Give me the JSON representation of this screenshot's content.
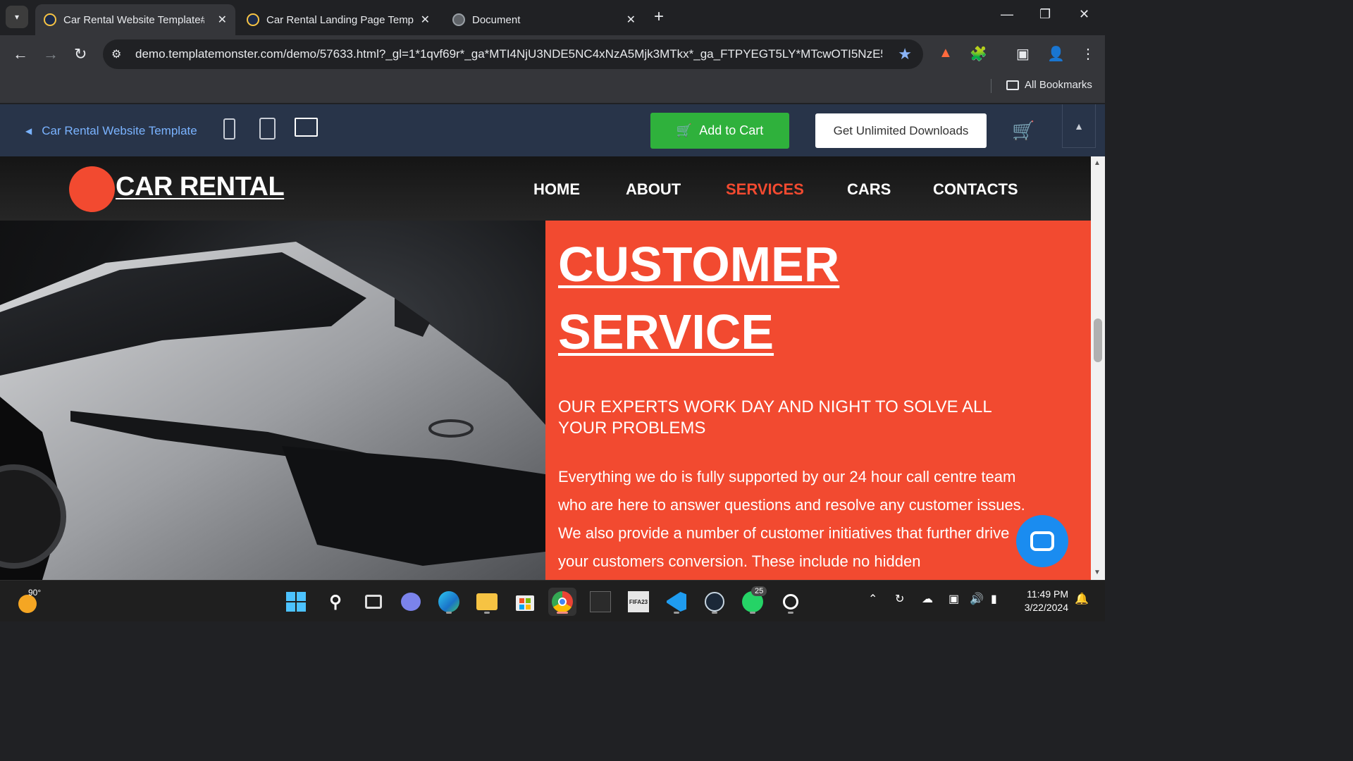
{
  "browser": {
    "tabs": [
      {
        "title": "Car Rental Website Template#5",
        "active": true
      },
      {
        "title": "Car Rental Landing Page Templ...",
        "active": false
      },
      {
        "title": "Document",
        "active": false
      }
    ],
    "url": "demo.templatemonster.com/demo/57633.html?_gl=1*1qvf69r*_ga*MTI4NjU3NDE5NC4xNzA5Mjk3MTkx*_ga_FTPYEGT5LY*MTcwOTI5NzE5...",
    "bookmarks_label": "All Bookmarks",
    "icons": {
      "tab_menu": "▾",
      "new_tab": "+",
      "minimize": "—",
      "restore": "❐",
      "close": "✕",
      "back": "←",
      "forward": "→",
      "reload": "↻",
      "tune": "⚙",
      "star": "★",
      "extension": "🧩",
      "sidepanel": "▣",
      "profile": "👤",
      "more": "⋮"
    }
  },
  "tm_bar": {
    "back_label": "Car Rental Website Template",
    "add_to_cart": "Add to Cart",
    "unlimited": "Get Unlimited Downloads",
    "colors": {
      "bar": "#283449",
      "cart_green": "#2fb13c"
    }
  },
  "site": {
    "logo_text": "CAR RENTAL",
    "nav": [
      {
        "label": "HOME",
        "active": false
      },
      {
        "label": "ABOUT",
        "active": false
      },
      {
        "label": "SERVICES",
        "active": true
      },
      {
        "label": "CARS",
        "active": false
      },
      {
        "label": "CONTACTS",
        "active": false
      }
    ],
    "hero": {
      "title_line1": "CUSTOMER",
      "title_line2": "SERVICE",
      "subtitle": "OUR EXPERTS WORK DAY AND NIGHT TO SOLVE ALL YOUR PROBLEMS",
      "body": "Everything we do is fully supported by our 24 hour call centre team who are here to answer questions and resolve any customer issues. We also provide a number of customer initiatives that further drive your customers conversion. These include no hidden"
    },
    "colors": {
      "accent": "#f24a30",
      "chat_blue": "#1a8cf0"
    }
  },
  "taskbar": {
    "weather_temp": "90°",
    "apps": [
      {
        "name": "start"
      },
      {
        "name": "search"
      },
      {
        "name": "task-view"
      },
      {
        "name": "teams"
      },
      {
        "name": "edge"
      },
      {
        "name": "file-explorer"
      },
      {
        "name": "store"
      },
      {
        "name": "chrome"
      },
      {
        "name": "pes"
      },
      {
        "name": "fifa"
      },
      {
        "name": "vscode"
      },
      {
        "name": "steam"
      },
      {
        "name": "whatsapp"
      },
      {
        "name": "other-app"
      }
    ],
    "whatsapp_badge": "25",
    "fifa_label": "FIFA23",
    "time": "11:49 PM",
    "date": "3/22/2024"
  }
}
